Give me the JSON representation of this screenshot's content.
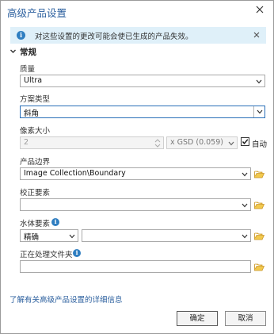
{
  "window": {
    "title": "高级产品设置",
    "close_label": "×"
  },
  "info_bar": {
    "icon": "info-icon",
    "text": "对这些设置的更改可能会使已生成的产品失效。"
  },
  "section": {
    "label": "常规",
    "expanded": true
  },
  "fields": {
    "quality": {
      "label": "质量",
      "value": "Ultra"
    },
    "scheme": {
      "label": "方案类型",
      "value": "斜角"
    },
    "pixel_size": {
      "label": "像素大小",
      "value": "2",
      "unit_value": "x GSD (0.059)",
      "auto_label": "自动",
      "auto_checked": true
    },
    "product_boundary": {
      "label": "产品边界",
      "value": "Image Collection\\Boundary"
    },
    "correction_features": {
      "label": "校正要素",
      "value": ""
    },
    "water_features": {
      "label": "水体要素",
      "mode_value": "精确",
      "value": ""
    },
    "processing_folder": {
      "label": "正在处理文件夹",
      "value": ""
    }
  },
  "footer": {
    "link": "了解有关高级产品设置的详细信息",
    "ok_label": "确定",
    "cancel_label": "取消"
  },
  "colors": {
    "title": "#2b5f9e",
    "info_background": "#dff0f9",
    "info_icon": "#2f7ec1",
    "folder": "#e3b341",
    "focus_border": "#2a6fb8"
  }
}
